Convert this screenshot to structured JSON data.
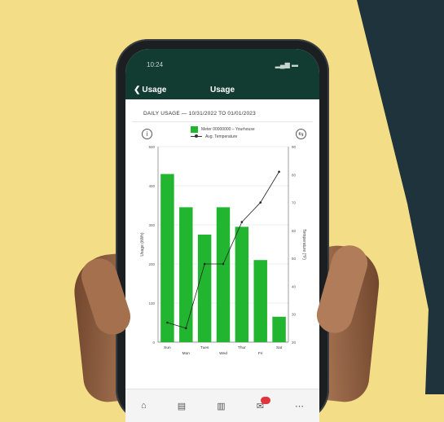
{
  "status_bar": {
    "time": "10:24",
    "signal": "▂▄▆",
    "battery": "▬"
  },
  "nav": {
    "back_label": "Usage",
    "title": "Usage"
  },
  "page": {
    "header": "DAILY USAGE — 10/31/2022 TO 01/01/2023"
  },
  "legend": {
    "bar_label": "Meter 00000000 – Yourhouse",
    "line_label": "Avg. Temperature"
  },
  "tabs": [
    "home-icon",
    "billing-icon",
    "usage-icon",
    "notifications-icon",
    "more-icon"
  ],
  "colors": {
    "bar": "#22b530",
    "line": "#222222",
    "header": "#123c32"
  },
  "chart_data": {
    "type": "bar",
    "categories": [
      "Sun",
      "Mon",
      "Tues",
      "Wed",
      "Thur",
      "Fri",
      "Sat"
    ],
    "ylabel": "Usage (kWh)",
    "y2label": "Temperature (°F)",
    "ylim": [
      0,
      500
    ],
    "yticks": [
      "0",
      "100",
      "200",
      "300",
      "400",
      "500"
    ],
    "y2lim": [
      20,
      90
    ],
    "y2ticks": [
      "20",
      "30",
      "40",
      "50",
      "60",
      "70",
      "80",
      "90"
    ],
    "series": [
      {
        "type": "bar",
        "values": [
          430,
          345,
          275,
          345,
          295,
          210,
          65
        ]
      },
      {
        "type": "line",
        "values": [
          27,
          25,
          48,
          48,
          63,
          70,
          81
        ]
      }
    ],
    "grid": true
  }
}
